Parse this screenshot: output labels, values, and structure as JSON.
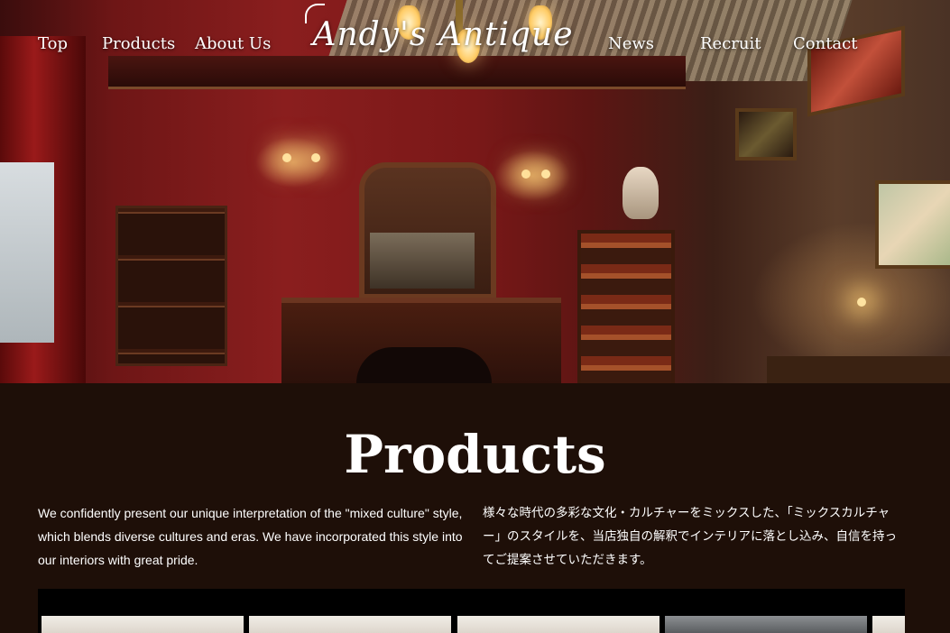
{
  "nav": {
    "left": [
      "Top",
      "Products",
      "About Us"
    ],
    "right": [
      "News",
      "Recruit",
      "Contact"
    ]
  },
  "brand": {
    "logo_text": "Andy's Antique"
  },
  "products": {
    "title": "Products",
    "description_en": "We confidently present our unique interpretation of the \"mixed culture\" style, which blends diverse cultures and eras. We have incorporated this style into our interiors with great pride.",
    "description_ja": "様々な時代の多彩な文化・カルチャーをミックスした、「ミックスカルチャー」のスタイルを、当店独自の解釈でインテリアに落とし込み、自信を持ってご提案させていただきます。"
  },
  "colors": {
    "page_bg": "#1e0f08",
    "gallery_bg": "#000000",
    "text": "#ffffff"
  }
}
